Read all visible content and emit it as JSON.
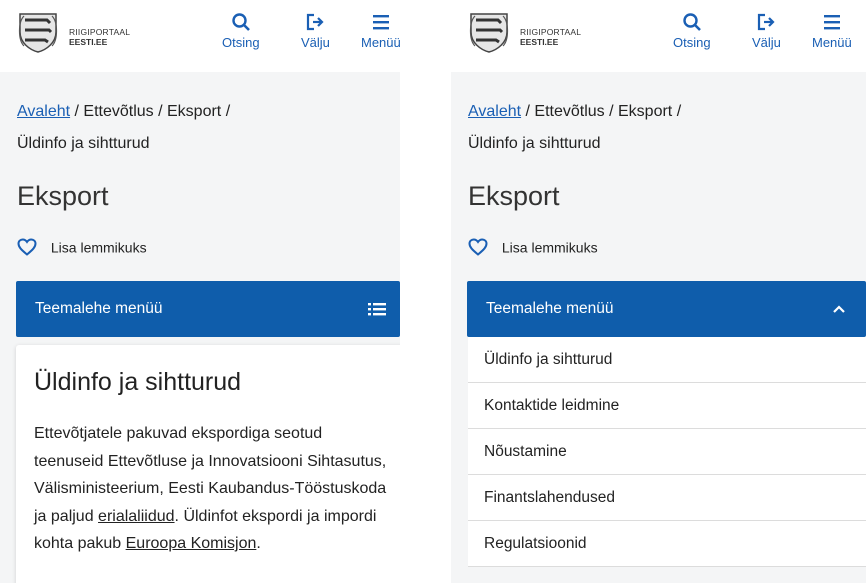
{
  "header": {
    "brand_line1": "RIIGIPORTAAL",
    "brand_line2": "EESTI.EE",
    "search_label": "Otsing",
    "logout_label": "Välju",
    "menu_label": "Menüü"
  },
  "breadcrumb": {
    "home": "Avaleht",
    "path": " / Ettevõtlus / Eksport /",
    "current": "Üldinfo ja sihtturud"
  },
  "page_title": "Eksport",
  "favorite_label": "Lisa lemmikuks",
  "topic_menu": {
    "label": "Teemalehe menüü",
    "items": [
      "Üldinfo ja sihtturud",
      "Kontaktide leidmine",
      "Nõustamine",
      "Finantslahendused",
      "Regulatsioonid"
    ]
  },
  "content": {
    "title": "Üldinfo ja sihtturud",
    "text1": "Ettevõtjatele pakuvad ekspordiga seotud teenuseid Ettevõtluse ja Innovatsiooni Sihtasutus, Välisministeerium, Eesti Kaubandus-Tööstuskoda ja paljud ",
    "link1": "erialaliidud",
    "text2": ". Üldinfot ekspordi ja impordi kohta pakub ",
    "link2": "Euroopa Komisjon",
    "text3": "."
  },
  "colors": {
    "accent": "#1a5fb4",
    "menu_bar": "#0f5dab",
    "background": "#f4f5f6"
  }
}
